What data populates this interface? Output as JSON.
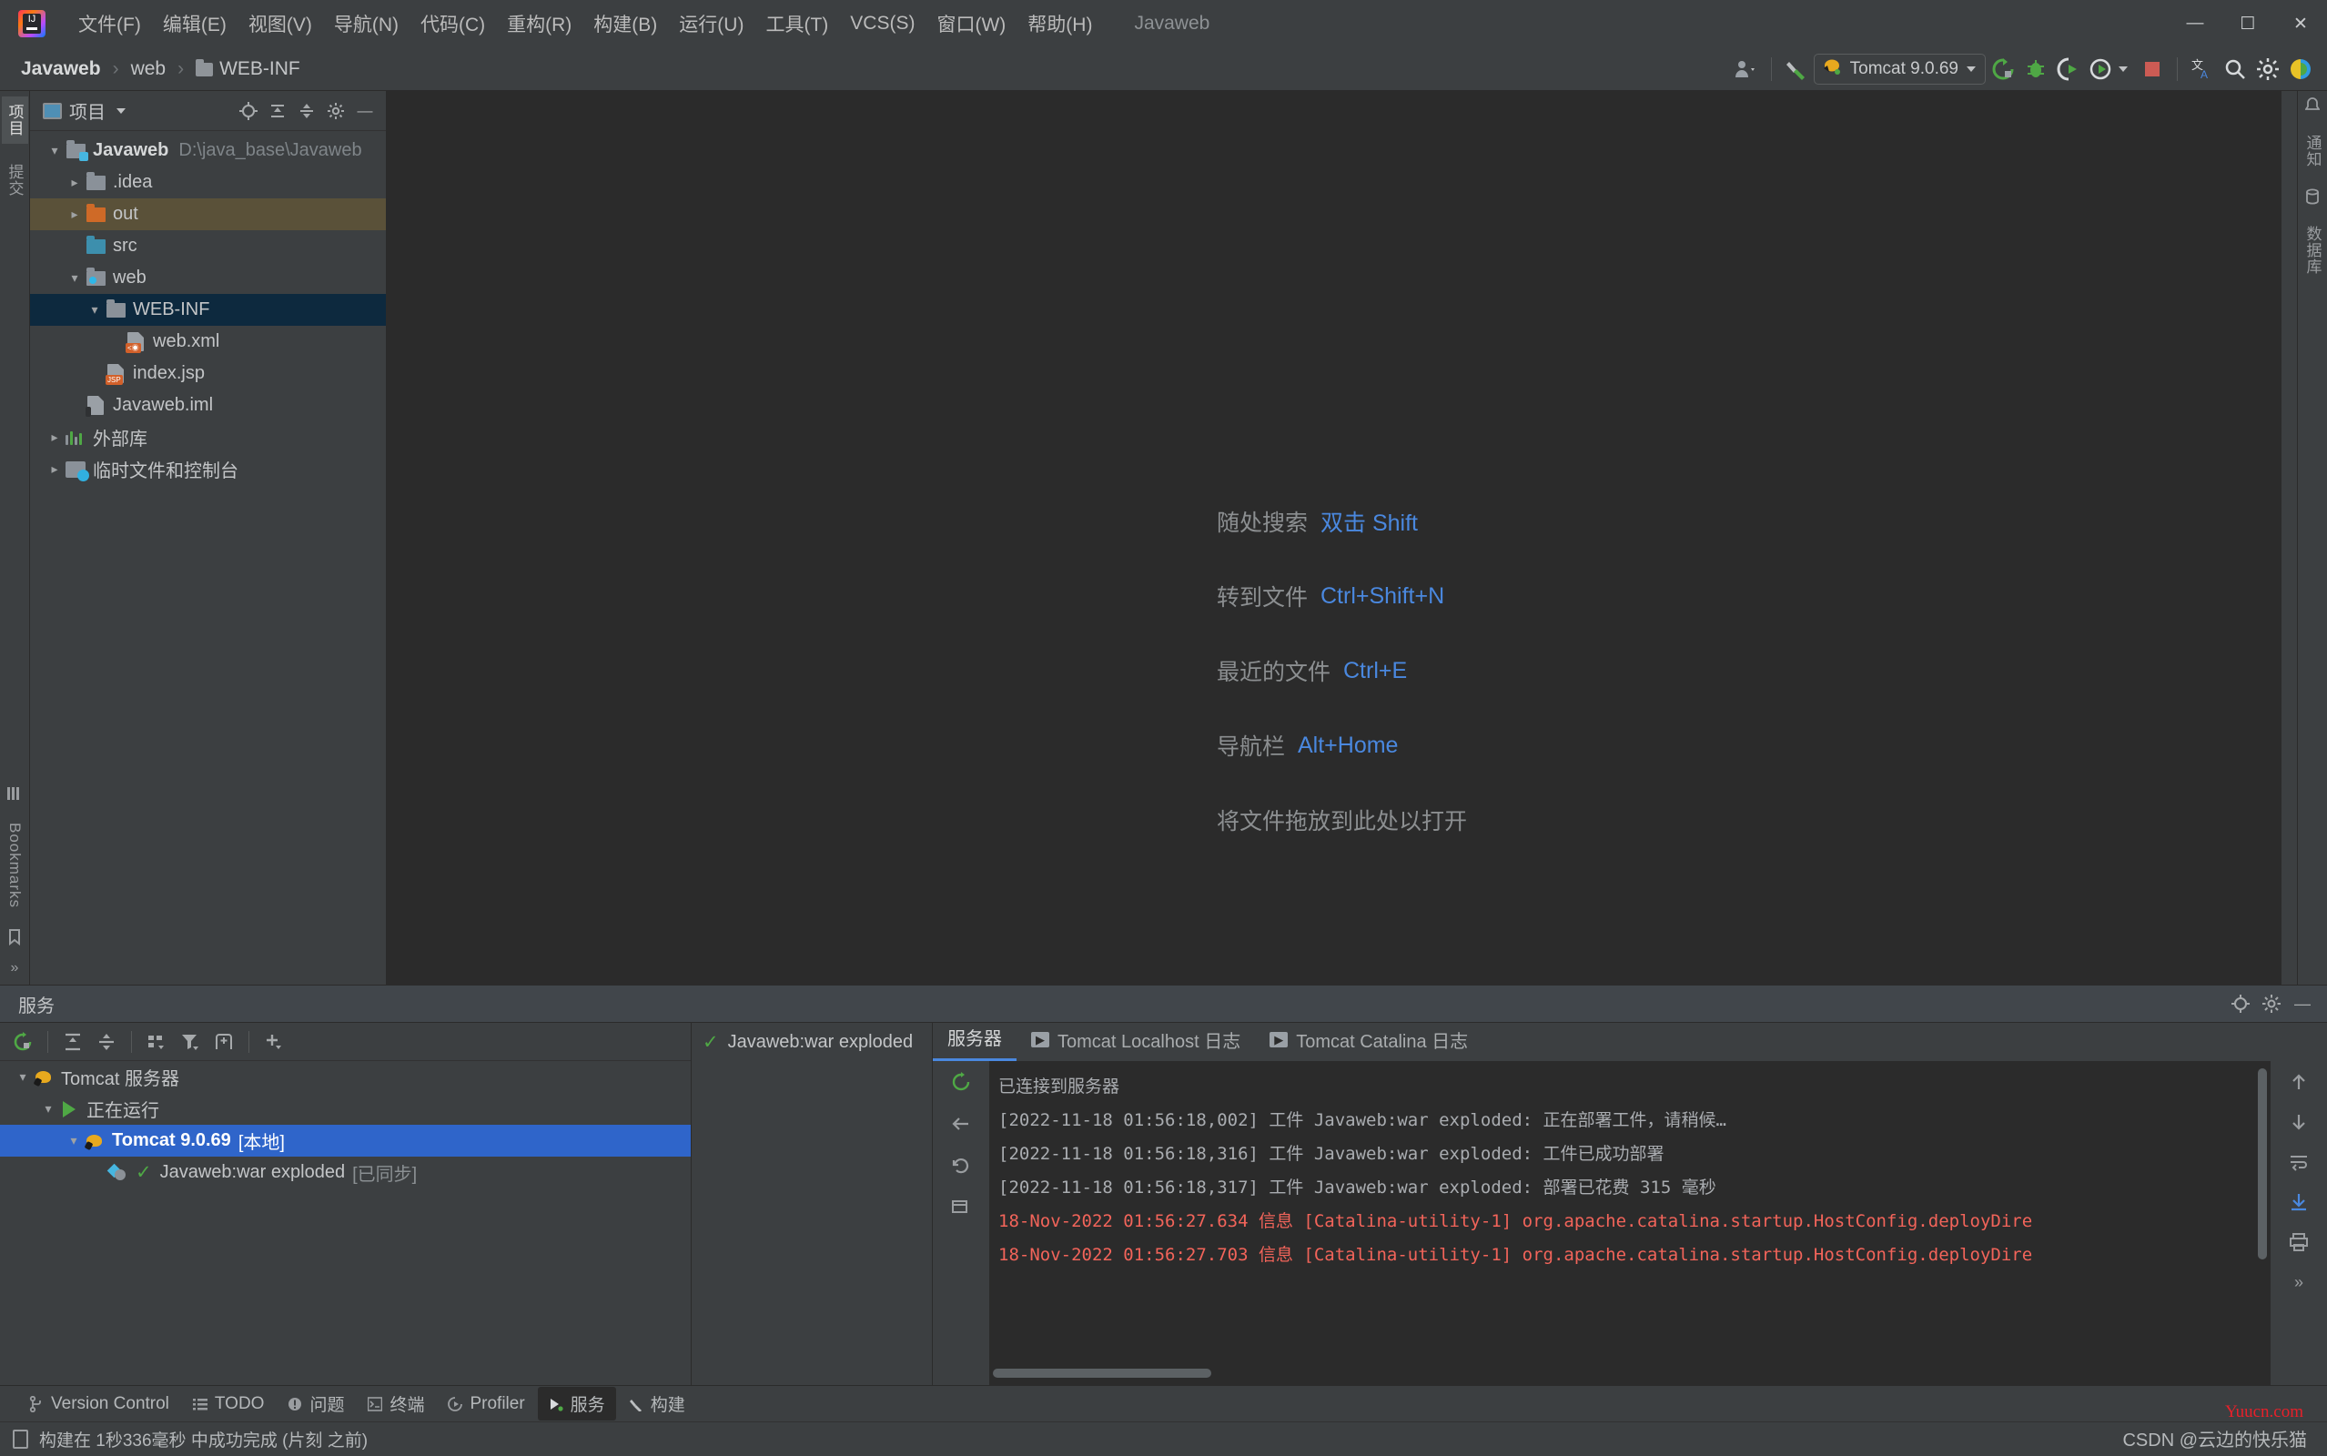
{
  "window": {
    "app_title": "Javaweb",
    "logo_text": "IJ",
    "minimize": "—",
    "maximize": "☐",
    "close": "✕"
  },
  "menubar": {
    "items": [
      {
        "label": "文件(F)"
      },
      {
        "label": "编辑(E)"
      },
      {
        "label": "视图(V)"
      },
      {
        "label": "导航(N)"
      },
      {
        "label": "代码(C)"
      },
      {
        "label": "重构(R)"
      },
      {
        "label": "构建(B)"
      },
      {
        "label": "运行(U)"
      },
      {
        "label": "工具(T)"
      },
      {
        "label": "VCS(S)"
      },
      {
        "label": "窗口(W)"
      },
      {
        "label": "帮助(H)"
      }
    ]
  },
  "navbar": {
    "breadcrumbs": [
      "Javaweb",
      "web",
      "WEB-INF"
    ],
    "separator": "›",
    "run_config": "Tomcat 9.0.69",
    "icons": {
      "user": "profile-icon",
      "build": "build-hammer-icon",
      "run": "run-icon",
      "debug": "debug-icon",
      "run_with_coverage": "coverage-icon",
      "profile": "profiler-icon",
      "stop": "stop-icon",
      "translate": "translate-icon",
      "search": "search-icon",
      "settings": "settings-icon",
      "ide_icon": "ide-feature-icon"
    }
  },
  "left_stripe": {
    "tabs": [
      "项目",
      "提交"
    ],
    "bottom_tabs": [
      "Bookmarks"
    ],
    "icons": [
      "structure-icon",
      "bookmarks-icon",
      "folder-icon"
    ]
  },
  "right_stripe": {
    "tabs": [
      "通知",
      "数据库"
    ]
  },
  "project": {
    "title": "项目",
    "tree": [
      {
        "indent": 0,
        "arrow": "open",
        "icon": "module-folder",
        "name": "Javaweb",
        "bold": true,
        "path": "D:\\java_base\\Javaweb",
        "state": "normal"
      },
      {
        "indent": 1,
        "arrow": "closed",
        "icon": "folder-grey",
        "name": ".idea",
        "bold": false,
        "path": "",
        "state": "normal"
      },
      {
        "indent": 1,
        "arrow": "closed",
        "icon": "folder-orange",
        "name": "out",
        "bold": false,
        "path": "",
        "state": "highlight"
      },
      {
        "indent": 1,
        "arrow": "none",
        "icon": "folder-blue",
        "name": "src",
        "bold": false,
        "path": "",
        "state": "normal"
      },
      {
        "indent": 1,
        "arrow": "open",
        "icon": "folder-web",
        "name": "web",
        "bold": false,
        "path": "",
        "state": "normal"
      },
      {
        "indent": 2,
        "arrow": "open",
        "icon": "folder-grey",
        "name": "WEB-INF",
        "bold": false,
        "path": "",
        "state": "selected"
      },
      {
        "indent": 3,
        "arrow": "none",
        "icon": "file-xml",
        "name": "web.xml",
        "bold": false,
        "path": "",
        "state": "normal"
      },
      {
        "indent": 2,
        "arrow": "none",
        "icon": "file-jsp",
        "name": "index.jsp",
        "bold": false,
        "path": "",
        "state": "normal"
      },
      {
        "indent": 1,
        "arrow": "none",
        "icon": "file-iml",
        "name": "Javaweb.iml",
        "bold": false,
        "path": "",
        "state": "normal"
      },
      {
        "indent": 0,
        "arrow": "closed",
        "icon": "library",
        "name": "外部库",
        "bold": false,
        "path": "",
        "state": "normal"
      },
      {
        "indent": 0,
        "arrow": "closed",
        "icon": "scratches",
        "name": "临时文件和控制台",
        "bold": false,
        "path": "",
        "state": "normal"
      }
    ]
  },
  "editor": {
    "hints": [
      {
        "label": "随处搜索",
        "key": "双击 Shift"
      },
      {
        "label": "转到文件",
        "key": "Ctrl+Shift+N"
      },
      {
        "label": "最近的文件",
        "key": "Ctrl+E"
      },
      {
        "label": "导航栏",
        "key": "Alt+Home"
      },
      {
        "label": "将文件拖放到此处以打开",
        "key": ""
      }
    ]
  },
  "services": {
    "header_title": "服务",
    "tree": [
      {
        "indent": 0,
        "arrow": "open",
        "icon": "tomcat",
        "name": "Tomcat 服务器",
        "sub": "",
        "state": "normal"
      },
      {
        "indent": 1,
        "arrow": "open",
        "icon": "running",
        "name": "正在运行",
        "sub": "",
        "state": "normal"
      },
      {
        "indent": 2,
        "arrow": "open",
        "icon": "tomcat-run",
        "name": "Tomcat 9.0.69",
        "sub": "[本地]",
        "state": "selected"
      },
      {
        "indent": 3,
        "arrow": "none",
        "icon": "artifact",
        "name": "Javaweb:war exploded",
        "sub": "[已同步]",
        "state": "normal"
      }
    ],
    "mid_panel": {
      "item": "Javaweb:war exploded"
    },
    "tabs": [
      {
        "label": "服务器",
        "icon": "",
        "active": true
      },
      {
        "label": "Tomcat Localhost 日志",
        "icon": "console-icon",
        "active": false
      },
      {
        "label": "Tomcat Catalina 日志",
        "icon": "console-icon",
        "active": false
      }
    ],
    "console_lines": [
      {
        "text": "已连接到服务器",
        "color": "grey"
      },
      {
        "text": "[2022-11-18 01:56:18,002] 工件 Javaweb:war exploded: 正在部署工件，请稍候…",
        "color": "grey"
      },
      {
        "text": "[2022-11-18 01:56:18,316] 工件 Javaweb:war exploded: 工件已成功部署",
        "color": "grey"
      },
      {
        "text": "[2022-11-18 01:56:18,317] 工件 Javaweb:war exploded: 部署已花费 315 毫秒",
        "color": "grey"
      },
      {
        "text": "18-Nov-2022 01:56:27.634 信息 [Catalina-utility-1] org.apache.catalina.startup.HostConfig.deployDire",
        "color": "red"
      },
      {
        "text": "18-Nov-2022 01:56:27.703 信息 [Catalina-utility-1] org.apache.catalina.startup.HostConfig.deployDire",
        "color": "red"
      }
    ]
  },
  "statusbar": {
    "tabs": [
      {
        "label": "Version Control",
        "icon": "branch-icon",
        "active": false
      },
      {
        "label": "TODO",
        "icon": "todo-icon",
        "active": false
      },
      {
        "label": "问题",
        "icon": "problems-icon",
        "active": false
      },
      {
        "label": "终端",
        "icon": "terminal-icon",
        "active": false
      },
      {
        "label": "Profiler",
        "icon": "profiler-icon",
        "active": false
      },
      {
        "label": "服务",
        "icon": "services-icon",
        "active": true
      },
      {
        "label": "构建",
        "icon": "build-icon",
        "active": false
      }
    ],
    "message": "构建在 1秒336毫秒 中成功完成 (片刻 之前)",
    "watermark": "CSDN @云边的快乐猫",
    "watermark_red": "Yuucn.com"
  },
  "colors": {
    "accent_blue": "#4a88df",
    "selection_blue": "#2f65ca",
    "tree_selection": "#0d293e",
    "highlight_row": "#5a5139",
    "error_red": "#f2645a",
    "green": "#4fa845",
    "orange": "#cf6a27"
  }
}
